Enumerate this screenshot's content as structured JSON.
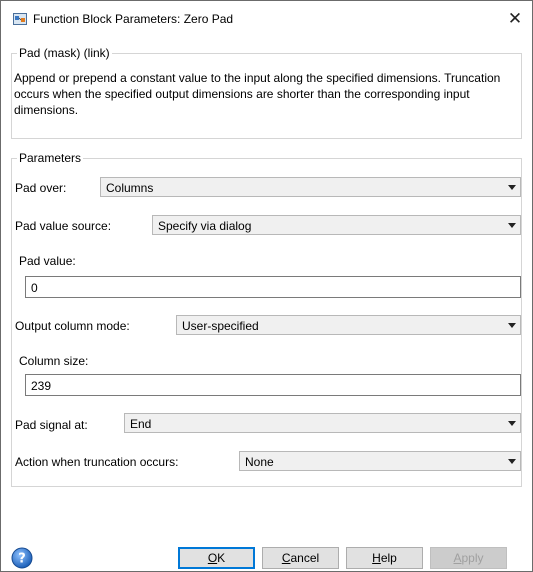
{
  "window": {
    "title": "Function Block Parameters: Zero Pad",
    "close_glyph": "✕"
  },
  "mask_group": {
    "legend": "Pad (mask) (link)",
    "description": "Append or prepend a constant value to the input along the specified dimensions.  Truncation occurs when the specified output dimensions are shorter than the corresponding input dimensions."
  },
  "parameters": {
    "legend": "Parameters",
    "pad_over": {
      "label": "Pad over:",
      "value": "Columns"
    },
    "pad_value_source": {
      "label": "Pad value source:",
      "value": "Specify via dialog"
    },
    "pad_value": {
      "label": "Pad value:",
      "value": "0"
    },
    "output_column_mode": {
      "label": "Output column mode:",
      "value": "User-specified"
    },
    "column_size": {
      "label": "Column size:",
      "value": "239"
    },
    "pad_signal_at": {
      "label": "Pad signal at:",
      "value": "End"
    },
    "action_truncation": {
      "label": "Action when truncation occurs:",
      "value": "None"
    }
  },
  "buttons": {
    "ok": {
      "mnemonic": "O",
      "rest": "K"
    },
    "cancel": {
      "mnemonic": "C",
      "rest": "ancel"
    },
    "help": {
      "mnemonic": "H",
      "rest": "elp"
    },
    "apply": {
      "mnemonic": "A",
      "rest": "pply",
      "enabled": false
    }
  },
  "icons": {
    "app": "simulink-block-icon",
    "help": "help-question-icon"
  }
}
